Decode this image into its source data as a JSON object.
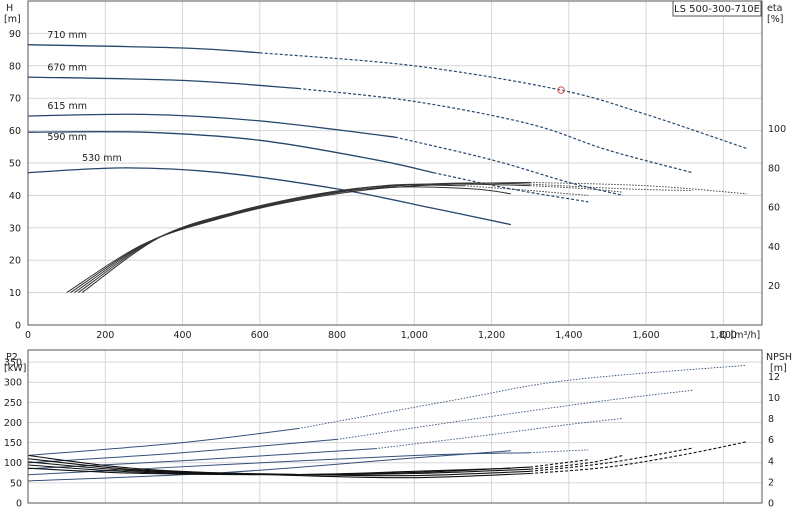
{
  "title": "LS 500-300-710E",
  "top": {
    "y_left_label": [
      "H",
      "[m]"
    ],
    "y_right_label": [
      "eta",
      "[%]"
    ],
    "x_label": "Q [m³/h]",
    "x_ticks": [
      "0",
      "200",
      "400",
      "600",
      "800",
      "1,000",
      "1,200",
      "1,400",
      "1,600",
      "1,800"
    ],
    "y_left_ticks": [
      "0",
      "10",
      "20",
      "30",
      "40",
      "50",
      "60",
      "70",
      "80",
      "90"
    ],
    "y_right_ticks": [
      "20",
      "40",
      "60",
      "80",
      "100"
    ]
  },
  "bottom": {
    "y_left_label": [
      "P2",
      "[kW]"
    ],
    "y_right_label": [
      "NPSH",
      "[m]"
    ],
    "y_left_ticks": [
      "0",
      "50",
      "100",
      "150",
      "200",
      "250",
      "300",
      "350"
    ],
    "y_right_ticks": [
      "0",
      "2",
      "4",
      "6",
      "8",
      "10",
      "12"
    ]
  },
  "chart_data": [
    {
      "type": "line",
      "title": "LS 500-300-710E",
      "xlabel": "Q [m³/h]",
      "ylabel": "H [m]",
      "y2label": "eta [%]",
      "xlim": [
        0,
        1900
      ],
      "ylim": [
        0,
        100
      ],
      "y2lim": [
        0,
        165
      ],
      "grid": true,
      "head_curves": [
        {
          "name": "710 mm",
          "solid": [
            [
              0,
              86.5
            ],
            [
              400,
              85.5
            ],
            [
              600,
              84
            ]
          ],
          "dashed": [
            [
              600,
              84
            ],
            [
              1000,
              80
            ],
            [
              1380,
              72.5
            ],
            [
              1600,
              65
            ],
            [
              1860,
              54.5
            ]
          ],
          "label_at": [
            50,
            88
          ]
        },
        {
          "name": "670 mm",
          "solid": [
            [
              0,
              76.5
            ],
            [
              400,
              75.5
            ],
            [
              700,
              73
            ]
          ],
          "dashed": [
            [
              700,
              73
            ],
            [
              1000,
              69
            ],
            [
              1300,
              62
            ],
            [
              1500,
              54
            ],
            [
              1720,
              47
            ]
          ],
          "label_at": [
            50,
            78
          ]
        },
        {
          "name": "615 mm",
          "solid": [
            [
              0,
              64.5
            ],
            [
              300,
              65
            ],
            [
              600,
              63
            ],
            [
              950,
              58
            ]
          ],
          "dashed": [
            [
              950,
              58
            ],
            [
              1200,
              51
            ],
            [
              1400,
              44
            ],
            [
              1540,
              40
            ]
          ],
          "label_at": [
            50,
            66
          ]
        },
        {
          "name": "590 mm",
          "solid": [
            [
              0,
              59.5
            ],
            [
              300,
              59.5
            ],
            [
              600,
              57
            ],
            [
              900,
              51
            ],
            [
              1050,
              47
            ]
          ],
          "dashed": [
            [
              1050,
              47
            ],
            [
              1250,
              42
            ],
            [
              1450,
              38
            ]
          ],
          "label_at": [
            50,
            56.5
          ]
        },
        {
          "name": "530 mm",
          "solid": [
            [
              0,
              47
            ],
            [
              250,
              48.5
            ],
            [
              500,
              47
            ],
            [
              800,
              42
            ],
            [
              1050,
              36
            ],
            [
              1250,
              31
            ]
          ],
          "dashed": [],
          "label_at": [
            140,
            50
          ]
        }
      ],
      "efficiency_curves": [
        {
          "solid": [
            [
              100,
              10
            ],
            [
              300,
              25
            ],
            [
              500,
              33
            ],
            [
              700,
              38.5
            ],
            [
              900,
              42
            ],
            [
              1100,
              43.5
            ],
            [
              1300,
              44
            ]
          ],
          "dashed": [
            [
              1300,
              44
            ],
            [
              1600,
              43
            ],
            [
              1860,
              40.5
            ]
          ]
        },
        {
          "solid": [
            [
              110,
              10
            ],
            [
              310,
              25.5
            ],
            [
              510,
              33.5
            ],
            [
              710,
              39
            ],
            [
              910,
              42.5
            ],
            [
              1110,
              43.8
            ],
            [
              1300,
              43.5
            ]
          ],
          "dashed": [
            [
              1300,
              43.5
            ],
            [
              1550,
              42
            ],
            [
              1720,
              41.5
            ]
          ]
        },
        {
          "solid": [
            [
              120,
              10
            ],
            [
              320,
              26
            ],
            [
              520,
              34
            ],
            [
              720,
              39.5
            ],
            [
              920,
              43
            ],
            [
              1120,
              43.5
            ],
            [
              1300,
              43
            ]
          ],
          "dashed": [
            [
              1300,
              43
            ],
            [
              1450,
              42
            ],
            [
              1540,
              41
            ]
          ]
        },
        {
          "solid": [
            [
              130,
              10
            ],
            [
              330,
              26.5
            ],
            [
              530,
              34.5
            ],
            [
              730,
              40
            ],
            [
              930,
              43
            ],
            [
              1130,
              43
            ]
          ],
          "dashed": [
            [
              1130,
              43
            ],
            [
              1300,
              41.5
            ],
            [
              1450,
              40
            ]
          ]
        },
        {
          "solid": [
            [
              140,
              10
            ],
            [
              340,
              27
            ],
            [
              540,
              35
            ],
            [
              740,
              40
            ],
            [
              940,
              42.5
            ],
            [
              1150,
              42
            ],
            [
              1250,
              40.5
            ]
          ],
          "dashed": []
        }
      ],
      "operating_point": [
        1380,
        72.5
      ]
    },
    {
      "type": "line",
      "ylabel": "P2 [kW]",
      "y2label": "NPSH [m]",
      "xlim": [
        0,
        1900
      ],
      "ylim": [
        0,
        380
      ],
      "y2lim": [
        0,
        14.5
      ],
      "grid": true,
      "power_curves": [
        {
          "solid": [
            [
              0,
              118
            ],
            [
              400,
              150
            ],
            [
              700,
              185
            ]
          ],
          "dashed": [
            [
              700,
              185
            ],
            [
              1100,
              255
            ],
            [
              1400,
              305
            ],
            [
              1860,
              342
            ]
          ]
        },
        {
          "solid": [
            [
              0,
              100
            ],
            [
              400,
              125
            ],
            [
              800,
              158
            ]
          ],
          "dashed": [
            [
              800,
              158
            ],
            [
              1200,
              215
            ],
            [
              1500,
              255
            ],
            [
              1720,
              280
            ]
          ]
        },
        {
          "solid": [
            [
              0,
              85
            ],
            [
              400,
              105
            ],
            [
              900,
              135
            ]
          ],
          "dashed": [
            [
              900,
              135
            ],
            [
              1200,
              170
            ],
            [
              1400,
              195
            ],
            [
              1540,
              210
            ]
          ]
        },
        {
          "solid": [
            [
              0,
              70
            ],
            [
              500,
              95
            ],
            [
              1000,
              118
            ],
            [
              1300,
              125
            ]
          ],
          "dashed": [
            [
              1300,
              125
            ],
            [
              1450,
              132
            ]
          ]
        },
        {
          "solid": [
            [
              0,
              55
            ],
            [
              500,
              75
            ],
            [
              1000,
              112
            ],
            [
              1250,
              130
            ]
          ],
          "dashed": []
        }
      ],
      "npsh_curves": [
        {
          "solid": [
            [
              0,
              4.5
            ],
            [
              300,
              3.2
            ],
            [
              700,
              2.6
            ],
            [
              1000,
              2.4
            ],
            [
              1300,
              2.8
            ]
          ],
          "dashed": [
            [
              1300,
              2.8
            ],
            [
              1500,
              3.4
            ],
            [
              1700,
              4.6
            ],
            [
              1860,
              5.8
            ]
          ]
        },
        {
          "solid": [
            [
              0,
              4.2
            ],
            [
              300,
              3.1
            ],
            [
              700,
              2.7
            ],
            [
              1000,
              2.6
            ],
            [
              1300,
              3.0
            ]
          ],
          "dashed": [
            [
              1300,
              3.0
            ],
            [
              1500,
              3.8
            ],
            [
              1720,
              5.2
            ]
          ]
        },
        {
          "solid": [
            [
              0,
              3.9
            ],
            [
              300,
              3.0
            ],
            [
              700,
              2.7
            ],
            [
              1000,
              2.8
            ],
            [
              1300,
              3.2
            ]
          ],
          "dashed": [
            [
              1300,
              3.2
            ],
            [
              1450,
              3.8
            ],
            [
              1540,
              4.5
            ]
          ]
        },
        {
          "solid": [
            [
              0,
              3.6
            ],
            [
              300,
              2.9
            ],
            [
              700,
              2.7
            ],
            [
              1000,
              2.9
            ],
            [
              1300,
              3.4
            ]
          ],
          "dashed": [
            [
              1300,
              3.4
            ],
            [
              1450,
              4.1
            ]
          ]
        },
        {
          "solid": [
            [
              0,
              3.3
            ],
            [
              300,
              2.8
            ],
            [
              700,
              2.7
            ],
            [
              1000,
              3.0
            ],
            [
              1250,
              3.3
            ]
          ],
          "dashed": []
        }
      ]
    }
  ],
  "colors": {
    "head": "#27466e",
    "efficiency": "#333333",
    "power": "#34507a",
    "npsh": "#111111",
    "grid": "#d6d6d6",
    "frame": "#555555",
    "marker": "#e05050"
  }
}
